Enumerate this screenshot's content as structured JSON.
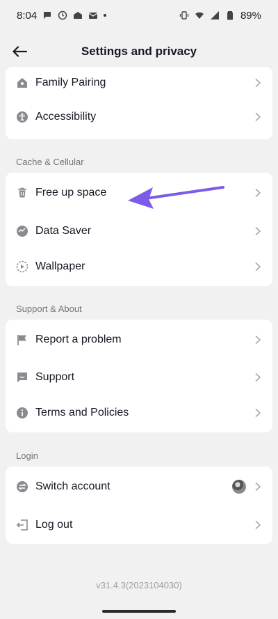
{
  "status_bar": {
    "time": "8:04",
    "battery": "89%"
  },
  "header": {
    "title": "Settings and privacy"
  },
  "groups": {
    "top": {
      "items": [
        {
          "label": "Family Pairing",
          "icon": "house-icon"
        },
        {
          "label": "Accessibility",
          "icon": "accessibility-icon"
        }
      ]
    },
    "cache": {
      "title": "Cache & Cellular",
      "items": [
        {
          "label": "Free up space",
          "icon": "trash-icon"
        },
        {
          "label": "Data Saver",
          "icon": "data-saver-icon"
        },
        {
          "label": "Wallpaper",
          "icon": "wallpaper-icon"
        }
      ]
    },
    "support": {
      "title": "Support & About",
      "items": [
        {
          "label": "Report a problem",
          "icon": "flag-icon"
        },
        {
          "label": "Support",
          "icon": "chat-icon"
        },
        {
          "label": "Terms and Policies",
          "icon": "info-icon"
        }
      ]
    },
    "login": {
      "title": "Login",
      "items": [
        {
          "label": "Switch account",
          "icon": "switch-icon"
        },
        {
          "label": "Log out",
          "icon": "logout-icon"
        }
      ]
    }
  },
  "footer": {
    "version": "v31.4.3(2023104030)"
  },
  "colors": {
    "background": "#f1f1f2",
    "card": "#ffffff",
    "annotation_arrow": "#7b5ce8"
  }
}
